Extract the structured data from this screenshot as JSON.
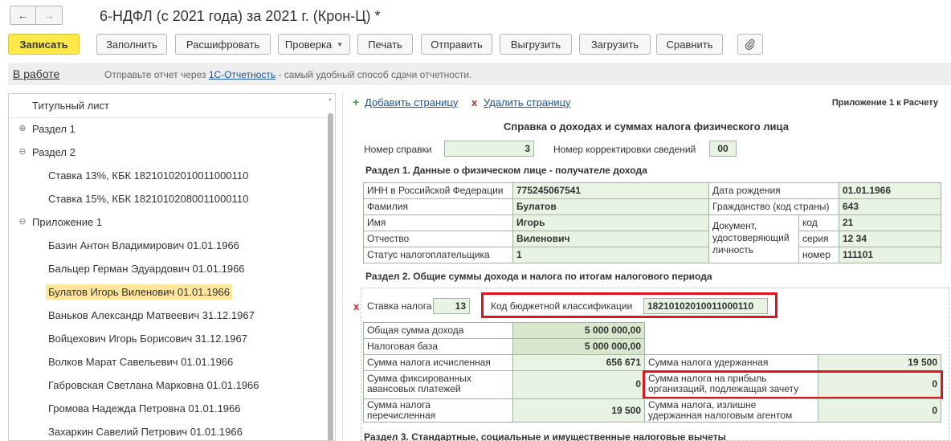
{
  "window": {
    "title": "6-НДФЛ (с 2021 года) за 2021 г. (Крон-Ц) *"
  },
  "nav": {
    "back": "←",
    "forward": "→"
  },
  "toolbar": {
    "save": "Записать",
    "fill": "Заполнить",
    "decode": "Расшифровать",
    "check": "Проверка",
    "print": "Печать",
    "send": "Отправить",
    "export": "Выгрузить",
    "import": "Загрузить",
    "compare": "Сравнить"
  },
  "info": {
    "state": "В работе",
    "msg_prefix": "Отправьте отчет через ",
    "msg_link": "1С-Отчетность",
    "msg_suffix": " - самый удобный способ сдачи отчетности."
  },
  "tree": {
    "items": [
      {
        "label": "Титульный лист"
      },
      {
        "label": "Раздел 1",
        "expander": "⊕"
      },
      {
        "label": "Раздел 2",
        "expander": "⊖"
      },
      {
        "label": "Ставка 13%, КБК 18210102010011000110"
      },
      {
        "label": "Ставка 15%, КБК 18210102080011000110"
      },
      {
        "label": "Приложение 1",
        "expander": "⊖"
      },
      {
        "label": "Базин Антон Владимирович 01.01.1966"
      },
      {
        "label": "Бальцер Герман Эдуардович 01.01.1966"
      },
      {
        "label": "Булатов Игорь Виленович 01.01.1966",
        "selected": true
      },
      {
        "label": "Ваньков Александр Матвеевич 31.12.1967"
      },
      {
        "label": "Войцехович Игорь Борисович 31.12.1967"
      },
      {
        "label": "Волков Марат Савельевич 01.01.1966"
      },
      {
        "label": "Габровская Светлана Марковна 01.01.1966"
      },
      {
        "label": "Громова Надежда Петровна 01.01.1966"
      },
      {
        "label": "Захаркин Савелий Петрович 01.01.1966"
      }
    ]
  },
  "report": {
    "add_page": "Добавить страницу",
    "delete_page": "Удалить страницу",
    "appendix": "Приложение 1 к Расчету",
    "heading": "Справка о доходах и суммах налога физического лица",
    "cert_number_label": "Номер справки",
    "cert_number": "3",
    "correction_label": "Номер корректировки сведений",
    "correction": "00",
    "section1_title": "Раздел 1. Данные о физическом лице - получателе дохода",
    "section1": {
      "inn_label": "ИНН в Российской Федерации",
      "inn": "775245067541",
      "surname_label": "Фамилия",
      "surname": "Булатов",
      "name_label": "Имя",
      "name": "Игорь",
      "patronymic_label": "Отчество",
      "patronymic": "Виленович",
      "status_label": "Статус налогоплательщика",
      "status": "1",
      "birth_label": "Дата рождения",
      "birth": "01.01.1966",
      "citizenship_label": "Гражданство (код страны)",
      "citizenship": "643",
      "doc_label_1": "Документ,",
      "doc_label_2": "удостоверяющий",
      "doc_label_3": "личность",
      "code_label": "код",
      "code": "21",
      "series_label": "серия",
      "series": "12 34",
      "number_label": "номер",
      "number": "111101"
    },
    "section2_title": "Раздел 2. Общие суммы дохода и налога по итогам налогового периода",
    "section2": {
      "rate_label": "Ставка налога",
      "rate": "13",
      "kbk_label": "Код бюджетной классификации",
      "kbk": "18210102010011000110",
      "total_income_label": "Общая сумма дохода",
      "total_income": "5 000 000,00",
      "tax_base_label": "Налоговая база",
      "tax_base": "5 000 000,00",
      "tax_calc_label": "Сумма налога исчисленная",
      "tax_calc": "656 671",
      "tax_withheld_label": "Сумма налога удержанная",
      "tax_withheld": "19 500",
      "fixed_adv_label_1": "Сумма фиксированных",
      "fixed_adv_label_2": "авансовых платежей",
      "fixed_adv": "0",
      "profit_tax_label_1": "Сумма налога на прибыль",
      "profit_tax_label_2": "организаций, подлежащая зачету",
      "profit_tax": "0",
      "transferred_label_1": "Сумма налога",
      "transferred_label_2": "перечисленная",
      "transferred": "19 500",
      "excess_label_1": "Сумма налога, излишне",
      "excess_label_2": "удержанная налоговым агентом",
      "excess": "0"
    },
    "section3_title": "Раздел 3. Стандартные, социальные и имущественные налоговые вычеты"
  },
  "colors": {
    "primary": "#fde94a",
    "highlight": "#e0141e",
    "cell_bg": "#e9f3e4",
    "selected": "#fde69b"
  }
}
